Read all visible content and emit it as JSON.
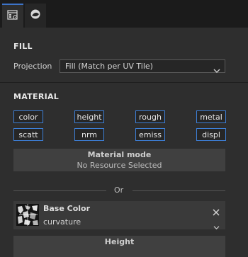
{
  "tabs": [
    {
      "icon": "layer-settings-icon"
    },
    {
      "icon": "material-sphere-icon"
    }
  ],
  "fill": {
    "title": "FILL",
    "projection_label": "Projection",
    "projection_value": "Fill (Match per UV Tile)"
  },
  "material": {
    "title": "MATERIAL",
    "channels": [
      "color",
      "height",
      "rough",
      "metal",
      "scatt",
      "nrm",
      "emiss",
      "displ"
    ],
    "mode_title": "Material mode",
    "mode_value": "No Resource Selected"
  },
  "or_label": "Or",
  "base_color": {
    "title": "Base Color",
    "source": "curvature"
  },
  "height": {
    "title": "Height",
    "value": ""
  },
  "colors": {
    "accent": "#3d7fd6",
    "panel": "#2e2e2e",
    "tabbar": "#1b1b1b"
  }
}
